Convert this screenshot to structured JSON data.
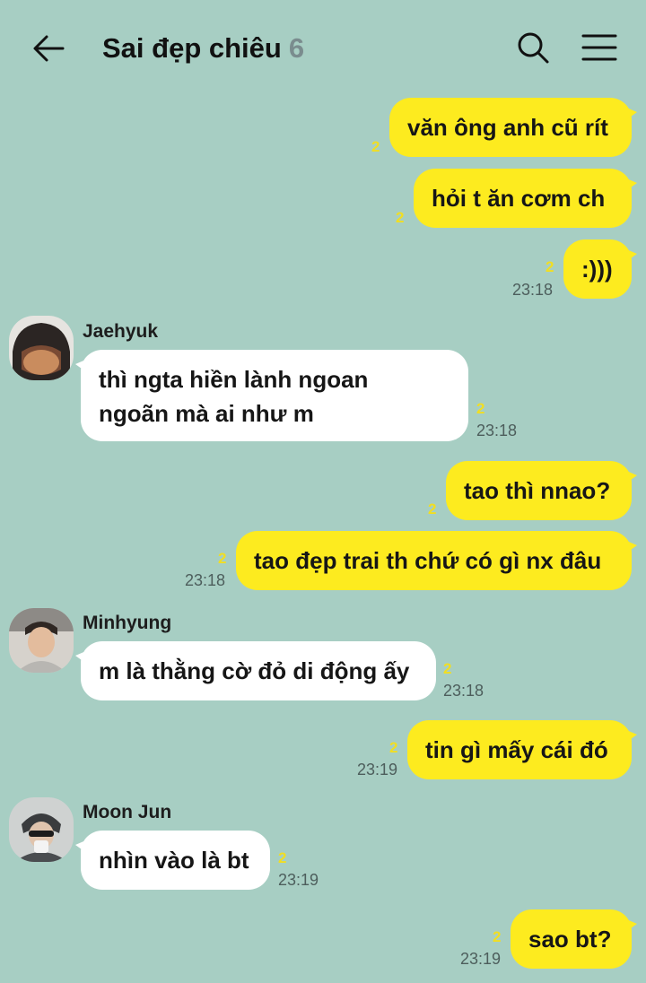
{
  "header": {
    "title": "Sai đẹp chiêu",
    "member_count": "6"
  },
  "messages": [
    {
      "from": "me",
      "text": "văn ông anh cũ rít",
      "unread": "2",
      "time": ""
    },
    {
      "from": "me",
      "text": "hỏi t ăn cơm ch",
      "unread": "2",
      "time": ""
    },
    {
      "from": "me",
      "text": ":)))",
      "unread": "2",
      "time": "23:18"
    },
    {
      "from": "Jaehyuk",
      "text_lines": [
        "thì ngta hiền lành ngoan",
        "ngoãn mà ai như m"
      ],
      "unread": "2",
      "time": "23:18"
    },
    {
      "from": "me",
      "text": "tao thì nnao?",
      "unread": "2",
      "time": ""
    },
    {
      "from": "me",
      "text": "tao đẹp trai th chứ có gì nx đâu",
      "unread": "2",
      "time": "23:18"
    },
    {
      "from": "Minhyung",
      "text": "m là thằng cờ đỏ di động ấy",
      "unread": "2",
      "time": "23:18"
    },
    {
      "from": "me",
      "text": "tin gì mấy cái đó",
      "unread": "2",
      "time": "23:19"
    },
    {
      "from": "Moon Jun",
      "text": "nhìn vào là bt",
      "unread": "2",
      "time": "23:19"
    },
    {
      "from": "me",
      "text": "sao bt?",
      "unread": "2",
      "time": "23:19"
    }
  ],
  "icons": {
    "back": "arrow-left-icon",
    "search": "search-icon",
    "menu": "hamburger-menu-icon"
  },
  "colors": {
    "background": "#a7cec3",
    "my_bubble": "#fdeb1f",
    "their_bubble": "#ffffff",
    "unread_badge": "#f1de22"
  }
}
